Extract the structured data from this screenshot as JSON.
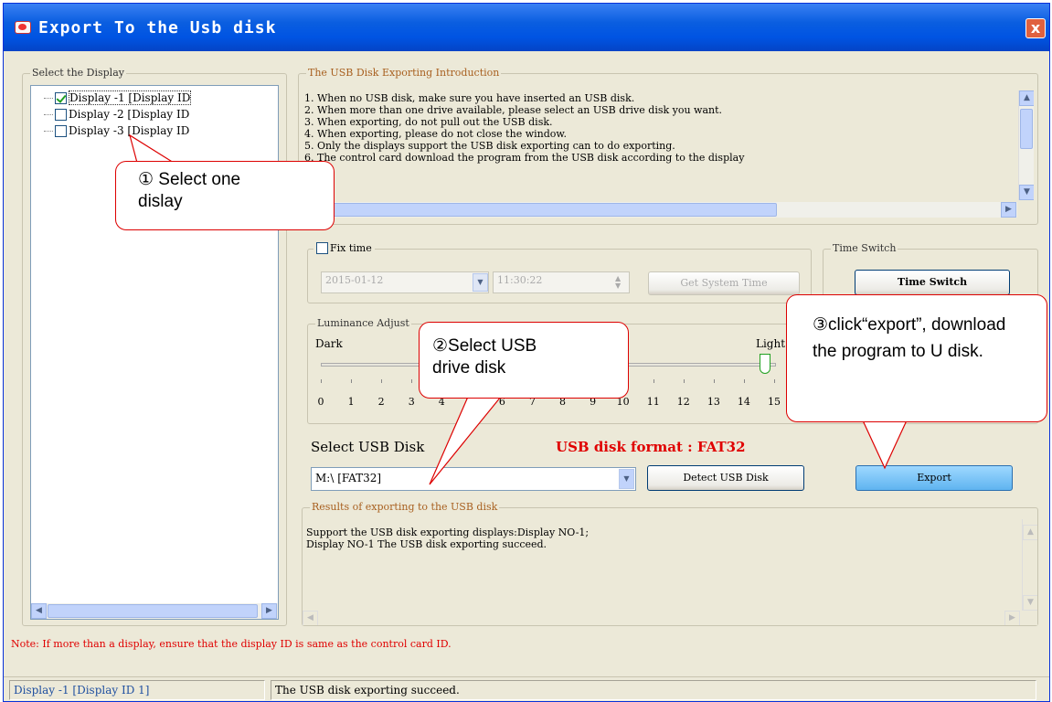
{
  "window": {
    "title": "Export To the Usb disk",
    "close_glyph": "x"
  },
  "left": {
    "group_label": "Select the Display",
    "displays": [
      {
        "label": "Display -1 [Display ID",
        "checked": true
      },
      {
        "label": "Display -2 [Display ID",
        "checked": false
      },
      {
        "label": "Display -3 [Display ID",
        "checked": false
      }
    ]
  },
  "intro": {
    "group_label": "The USB Disk Exporting Introduction",
    "lines": [
      "1. When no USB disk, make sure you have inserted an USB disk.",
      "2. When more than one drive available, please select an USB drive disk you want.",
      "3. When exporting, do not pull out the USB disk.",
      "4. When exporting, please do not close the window.",
      "5. Only the displays support the USB disk exporting can to do exporting.",
      "6. The control card download the program from the USB disk according to the display"
    ]
  },
  "fix_time": {
    "label": "Fix time",
    "date_value": "2015-01-12",
    "time_value": "11:30:22",
    "get_time_label": "Get System Time"
  },
  "time_switch": {
    "group_label": "Time Switch",
    "button_label": "Time Switch"
  },
  "luminance": {
    "group_label": "Luminance Adjust",
    "dark_label": "Dark",
    "light_label": "Light",
    "ticks": [
      "0",
      "1",
      "2",
      "3",
      "4",
      "5",
      "6",
      "7",
      "8",
      "9",
      "10",
      "11",
      "12",
      "13",
      "14",
      "15"
    ],
    "value": 15
  },
  "usb": {
    "select_label": "Select USB Disk",
    "format_label": "USB disk format : FAT32",
    "selected_disk": "M:\\ [FAT32]",
    "detect_label": "Detect USB Disk",
    "export_label": "Export"
  },
  "results": {
    "group_label": "Results of exporting to the USB disk",
    "lines": [
      "Support the USB disk exporting displays:Display NO-1;",
      "Display NO-1 The USB disk exporting succeed."
    ]
  },
  "note": "Note: If more than a display, ensure that the display ID is same as the control card ID.",
  "status": {
    "cell1": "Display -1 [Display ID  1]",
    "cell2": "The USB disk exporting succeed."
  },
  "callouts": {
    "one": "① Select one dislay",
    "two": "②Select USB drive disk",
    "three": "③click“export”, download the program to U disk."
  },
  "colors": {
    "note_red": "#e00000",
    "format_red": "#e00000",
    "callout_border": "#dd0000",
    "title_blue": "#0054e3"
  }
}
